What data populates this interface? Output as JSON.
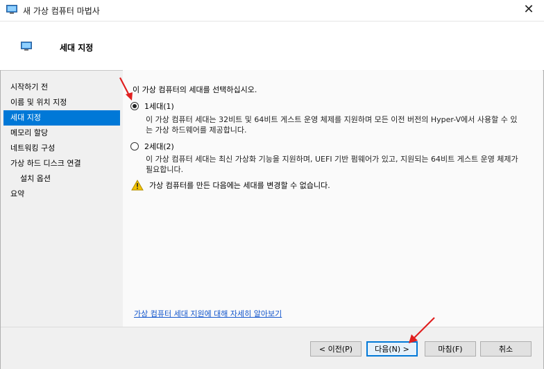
{
  "window": {
    "title": "새 가상 컴퓨터 마법사",
    "close_glyph": "✕"
  },
  "header": {
    "title": "세대 지정"
  },
  "nav": {
    "items": [
      {
        "label": "시작하기 전"
      },
      {
        "label": "이름 및 위치 지정"
      },
      {
        "label": "세대 지정"
      },
      {
        "label": "메모리 할당"
      },
      {
        "label": "네트워킹 구성"
      },
      {
        "label": "가상 하드 디스크 연결"
      },
      {
        "label": "설치 옵션"
      },
      {
        "label": "요약"
      }
    ],
    "selected_index": 2
  },
  "content": {
    "intro": "이 가상 컴퓨터의 세대를 선택하십시오.",
    "gen1": {
      "label": "1세대(1)",
      "checked": true,
      "desc": "이 가상 컴퓨터 세대는 32비트 및 64비트 게스트 운영 체제를 지원하며 모든 이전 버전의 Hyper-V에서 사용할 수 있는 가상 하드웨어를 제공합니다."
    },
    "gen2": {
      "label": "2세대(2)",
      "checked": false,
      "desc": "이 가상 컴퓨터 세대는 최신 가상화 기능을 지원하며, UEFI 기반 펌웨어가 있고, 지원되는 64비트 게스트 운영 체제가 필요합니다."
    },
    "warning": "가상 컴퓨터를 만든 다음에는 세대를 변경할 수 없습니다.",
    "learn_link": "가상 컴퓨터 세대 지원에 대해 자세히 알아보기"
  },
  "buttons": {
    "prev": "< 이전(P)",
    "next": "다음(N) >",
    "finish": "마침(F)",
    "cancel": "취소"
  },
  "colors": {
    "accent": "#0078d7",
    "annotation_arrow": "#e02020",
    "warning": "#f2c200"
  }
}
